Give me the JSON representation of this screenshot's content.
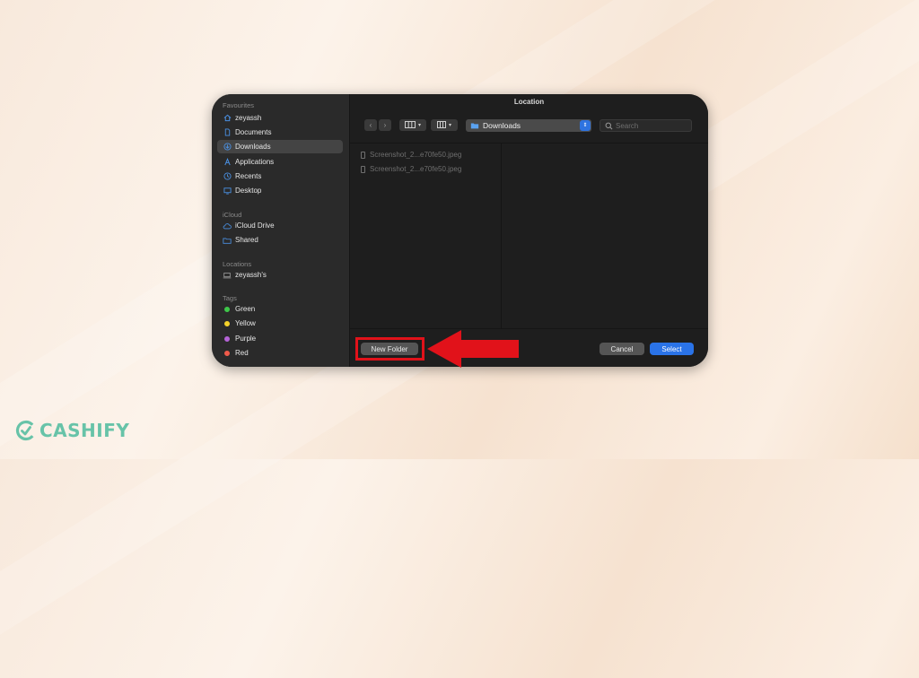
{
  "window": {
    "title": "Location"
  },
  "sidebar": {
    "favourites_title": "Favourites",
    "favourites": [
      {
        "label": "zeyassh",
        "icon": "home-icon"
      },
      {
        "label": "Documents",
        "icon": "document-icon"
      },
      {
        "label": "Downloads",
        "icon": "download-icon",
        "selected": true
      },
      {
        "label": "Applications",
        "icon": "applications-icon"
      },
      {
        "label": "Recents",
        "icon": "clock-icon"
      },
      {
        "label": "Desktop",
        "icon": "desktop-icon"
      }
    ],
    "icloud_title": "iCloud",
    "icloud": [
      {
        "label": "iCloud Drive",
        "icon": "cloud-icon"
      },
      {
        "label": "Shared",
        "icon": "shared-folder-icon"
      }
    ],
    "locations_title": "Locations",
    "locations": [
      {
        "label": "zeyassh's",
        "icon": "laptop-icon"
      }
    ],
    "tags_title": "Tags",
    "tags": [
      {
        "label": "Green",
        "color": "#3ec74a"
      },
      {
        "label": "Yellow",
        "color": "#f4d22a"
      },
      {
        "label": "Purple",
        "color": "#b463d6"
      },
      {
        "label": "Red",
        "color": "#f05a4a"
      }
    ]
  },
  "toolbar": {
    "location": "Downloads",
    "search_placeholder": "Search"
  },
  "files": [
    {
      "name": "Screenshot_2...e70fe50.jpeg"
    },
    {
      "name": "Screenshot_2...e70fe50.jpeg"
    }
  ],
  "footer": {
    "new_folder": "New Folder",
    "cancel": "Cancel",
    "select": "Select"
  },
  "brand": {
    "name": "CASHIFY",
    "color": "#67c3a8"
  },
  "annotation": {
    "color": "#e1121a"
  }
}
